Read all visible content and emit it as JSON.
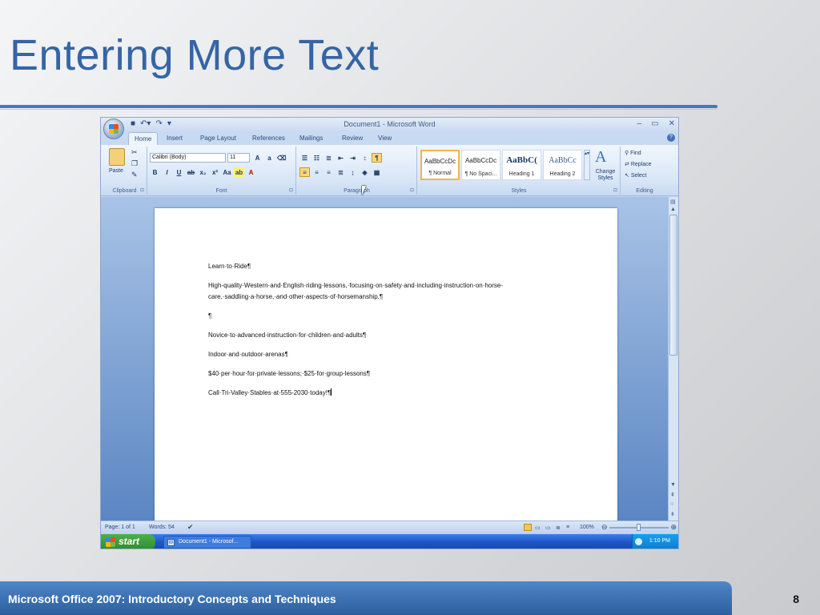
{
  "slide": {
    "title": "Entering More Text",
    "footer": "Microsoft Office 2007: Introductory Concepts and Techniques",
    "page_number": "8"
  },
  "window": {
    "title": "Document1 - Microsoft Word",
    "controls": [
      "–",
      "▭",
      "✕"
    ],
    "qat_icons": [
      "save-icon",
      "undo-icon",
      "redo-icon",
      "customize-icon"
    ]
  },
  "ribbon": {
    "tabs": [
      "Home",
      "Insert",
      "Page Layout",
      "References",
      "Mailings",
      "Review",
      "View"
    ],
    "active_tab": "Home",
    "groups": {
      "clipboard": {
        "label": "Clipboard",
        "paste": "Paste"
      },
      "font": {
        "label": "Font",
        "font_name": "Calibri (Body)",
        "font_size": "11"
      },
      "paragraph": {
        "label": "Paragraph"
      },
      "styles": {
        "label": "Styles",
        "items": [
          {
            "sample": "AaBbCcDc",
            "name": "¶ Normal"
          },
          {
            "sample": "AaBbCcDc",
            "name": "¶ No Spaci..."
          },
          {
            "sample": "AaBbC(",
            "name": "Heading 1"
          },
          {
            "sample": "AaBbCc",
            "name": "Heading 2"
          }
        ],
        "change_styles": "Change Styles"
      },
      "editing": {
        "label": "Editing",
        "find": "Find",
        "replace": "Replace",
        "select": "Select"
      }
    }
  },
  "document": {
    "paragraphs": [
      "Learn·to·Ride¶",
      "High-quality·Western·and·English·riding·lessons,·focusing·on·safety·and·including·instruction·on·horse-",
      "care,·saddling·a·horse,·and·other·aspects·of·horsemanship.¶",
      "¶",
      "Novice·to·advanced·instruction·for·children·and·adults¶",
      "Indoor·and·outdoor·arenas¶",
      "$40·per·hour·for·private·lessons;·$25·for·group·lessons¶",
      "Call·Tri-Valley·Stables·at·555-2030·today!¶"
    ]
  },
  "statusbar": {
    "page": "Page: 1 of 1",
    "words": "Words: 54",
    "zoom": "100%"
  },
  "taskbar": {
    "start": "start",
    "task": "Document1 - Microsof...",
    "clock": "1:10 PM"
  }
}
